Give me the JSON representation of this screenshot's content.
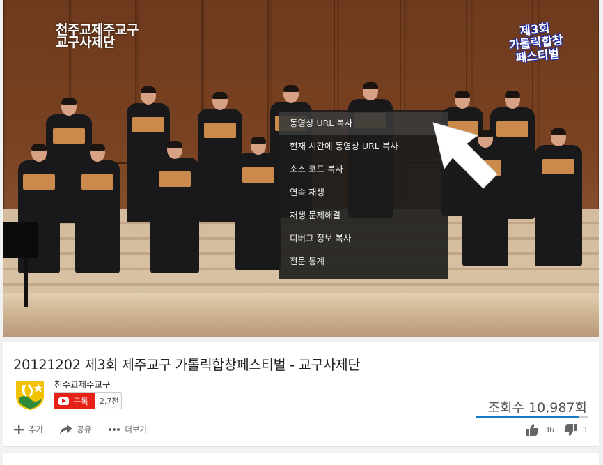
{
  "overlay": {
    "left_line1": "천주교제주교구",
    "left_line2": "교구사제단",
    "right_line1": "제3회",
    "right_line2": "가톨릭합창",
    "right_line3": "페스티벌"
  },
  "context_menu": {
    "items": [
      {
        "label": "동영상 URL 복사",
        "active": true
      },
      {
        "label": "현재 시간에 동영상 URL 복사",
        "active": false
      },
      {
        "label": "소스 코드 복사",
        "active": false
      },
      {
        "label": "연속 재생",
        "active": false
      },
      {
        "label": "재생 문제해결",
        "active": false
      },
      {
        "label": "디버그 정보 복사",
        "active": false
      },
      {
        "label": "전문 통계",
        "active": false
      }
    ]
  },
  "video": {
    "title": "20121202 제3회 제주교구 가톨릭합창페스티벌 - 교구사제단",
    "views": "조회수 10,987회",
    "like_ratio": 0.92
  },
  "channel": {
    "name": "천주교제주교구",
    "subscribe_label": "구독",
    "subscriber_count": "2.7천"
  },
  "actions": {
    "add_label": "추가",
    "share_label": "공유",
    "more_label": "더보기"
  },
  "rating": {
    "likes": "36",
    "dislikes": "3"
  },
  "colors": {
    "subscribe_red": "#e62117",
    "like_bar_blue": "#167ac6"
  }
}
